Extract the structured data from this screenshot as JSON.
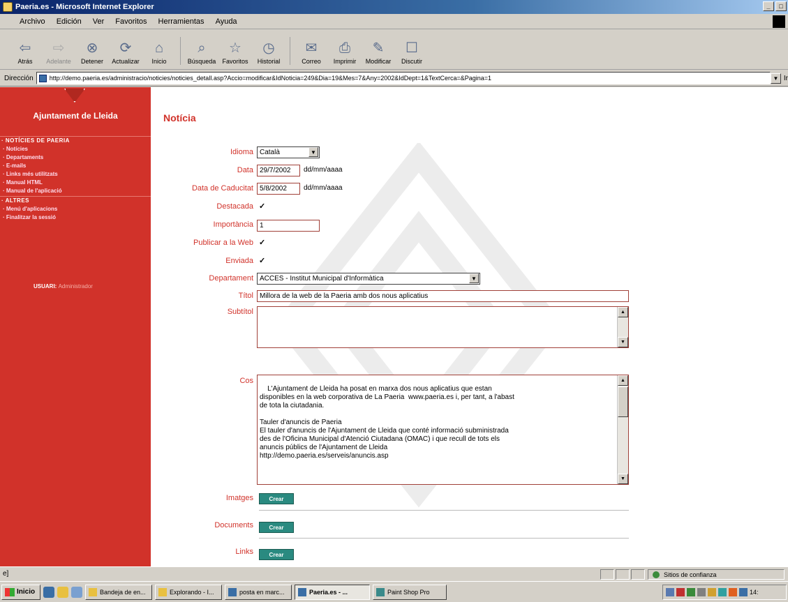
{
  "window": {
    "title": "Paeria.es - Microsoft Internet Explorer"
  },
  "menu": [
    "Archivo",
    "Edición",
    "Ver",
    "Favoritos",
    "Herramientas",
    "Ayuda"
  ],
  "toolbar": [
    {
      "label": "Atrás",
      "icon": "back-arrow-icon",
      "glyph": "⇦",
      "dim": false
    },
    {
      "label": "Adelante",
      "icon": "forward-arrow-icon",
      "glyph": "⇨",
      "dim": true
    },
    {
      "label": "Detener",
      "icon": "stop-icon",
      "glyph": "⊗",
      "dim": false
    },
    {
      "label": "Actualizar",
      "icon": "refresh-icon",
      "glyph": "⟳",
      "dim": false
    },
    {
      "label": "Inicio",
      "icon": "home-icon",
      "glyph": "⌂",
      "dim": false
    },
    {
      "label": "Búsqueda",
      "icon": "search-icon",
      "glyph": "⌕",
      "dim": false
    },
    {
      "label": "Favoritos",
      "icon": "favorites-icon",
      "glyph": "☆",
      "dim": false
    },
    {
      "label": "Historial",
      "icon": "history-icon",
      "glyph": "◷",
      "dim": false
    },
    {
      "label": "Correo",
      "icon": "mail-icon",
      "glyph": "✉",
      "dim": false
    },
    {
      "label": "Imprimir",
      "icon": "print-icon",
      "glyph": "⎙",
      "dim": false
    },
    {
      "label": "Modificar",
      "icon": "edit-icon",
      "glyph": "✎",
      "dim": false
    },
    {
      "label": "Discutir",
      "icon": "discuss-icon",
      "glyph": "☐",
      "dim": false
    }
  ],
  "address": {
    "label": "Dirección",
    "url": "http://demo.paeria.es/administracio/noticies/noticies_detall.asp?Accio=modificar&IdNoticia=249&Dia=19&Mes=7&Any=2002&IdDept=1&TextCerca=&Pagina=1",
    "go": "Ir"
  },
  "nav": {
    "org": "Ajuntament de Lleida",
    "section1": "· NOTÍCIES DE PAERIA",
    "items1": [
      "· Notícies",
      "· Departaments",
      "· E-mails",
      "· Links més utilitzats",
      "· Manual HTML",
      "· Manual de l'aplicació"
    ],
    "section2": "· ALTRES",
    "items2": [
      "· Menú d'aplicacions",
      "· Finalitzar la sessió"
    ],
    "user_label": "USUARI:",
    "user_name": "Administrador"
  },
  "form": {
    "title": "Notícia",
    "idioma_label": "Idioma",
    "idioma_value": "Català",
    "data_label": "Data",
    "data_value": "29/7/2002",
    "data_hint": "dd/mm/aaaa",
    "caducitat_label": "Data de Caducitat",
    "caducitat_value": "5/8/2002",
    "caducitat_hint": "dd/mm/aaaa",
    "destacada_label": "Destacada",
    "importancia_label": "Importància",
    "importancia_value": "1",
    "publicar_label": "Publicar a la Web",
    "enviada_label": "Enviada",
    "departament_label": "Departament",
    "departament_value": "ACCES - Institut Municipal d'Informàtica",
    "titol_label": "Títol",
    "titol_value": "Millora de la web de la Paeria amb dos nous aplicatius",
    "subtitol_label": "Subtítol",
    "subtitol_value": "",
    "cos_label": "Cos",
    "cos_value": "L'Ajuntament de Lleida ha posat en marxa dos nous aplicatius que estan\ndisponibles en la web corporativa de La Paeria  www.paeria.es i, per tant, a l'abast\nde tota la ciutadania.\n\nTauler d'anuncis de Paeria\nEl tauler d'anuncis de l'Ajuntament de Lleida que conté informació subministrada\ndes de l'Oficina Municipal d'Atenció Ciutadana (OMAC) i que recull de tots els\nanuncis públics de l'Ajuntament de Lleida\nhttp://demo.paeria.es/serveis/anuncis.asp",
    "imatges_label": "Imatges",
    "documents_label": "Documents",
    "links_label": "Links",
    "crear_label": "Crear"
  },
  "status": {
    "zone": "Sitios de confianza"
  },
  "taskbar": {
    "start": "Inicio",
    "tasks": [
      {
        "label": "Bandeja de en...",
        "active": false
      },
      {
        "label": "Explorando - I...",
        "active": false
      },
      {
        "label": "posta en marc...",
        "active": false
      },
      {
        "label": "Paeria.es - ...",
        "active": true
      },
      {
        "label": "Paint Shop Pro",
        "active": false
      }
    ],
    "clock": "14:"
  },
  "colors": {
    "brand_red": "#d1322a",
    "crear_teal": "#2a8a80",
    "title_blue": "#0a246a"
  }
}
